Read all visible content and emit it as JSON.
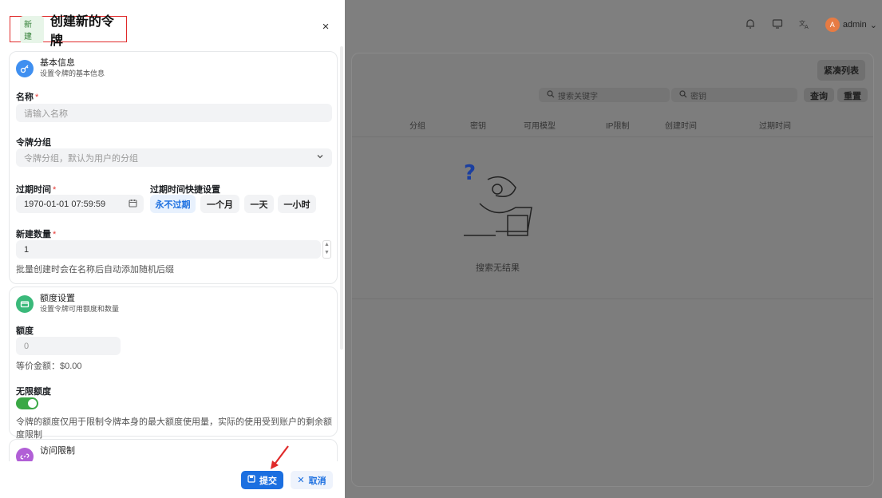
{
  "sheet": {
    "tag": "新建",
    "title": "创建新的令牌",
    "close_icon": "×"
  },
  "basic": {
    "title": "基本信息",
    "subtitle": "设置令牌的基本信息",
    "name_label": "名称",
    "name_placeholder": "请输入名称",
    "group_label": "令牌分组",
    "group_placeholder": "令牌分组，默认为用户的分组",
    "expire_label": "过期时间",
    "expire_value": "1970-01-01 07:59:59",
    "quick_label": "过期时间快捷设置",
    "quick_options": [
      "永不过期",
      "一个月",
      "一天",
      "一小时"
    ],
    "count_label": "新建数量",
    "count_value": "1",
    "count_helper": "批量创建时会在名称后自动添加随机后缀"
  },
  "quota": {
    "title": "额度设置",
    "subtitle": "设置令牌可用额度和数量",
    "quota_label": "额度",
    "quota_placeholder": "0",
    "equivalent": "等价金额：$0.00",
    "unlimited_label": "无限额度",
    "unlimited_on": true,
    "unlimited_helper": "令牌的额度仅用于限制令牌本身的最大额度使用量，实际的使用受到账户的剩余额度限制"
  },
  "access": {
    "title": "访问限制"
  },
  "footer": {
    "submit": "提交",
    "cancel": "取消"
  },
  "background": {
    "user": "admin",
    "avatar_letter": "A",
    "compact_button": "紧凑列表",
    "search_keyword_placeholder": "搜索关键字",
    "search_key_placeholder": "密钥",
    "query_button": "查询",
    "reset_button": "重置",
    "columns": [
      "分组",
      "密钥",
      "可用模型",
      "IP限制",
      "创建时间",
      "过期时间"
    ],
    "empty_text": "搜索无结果"
  },
  "colors": {
    "primary": "#1b6fe0",
    "toggle_on": "#3aa845",
    "required": "#e53935",
    "highlight_box": "#e02a2a"
  }
}
